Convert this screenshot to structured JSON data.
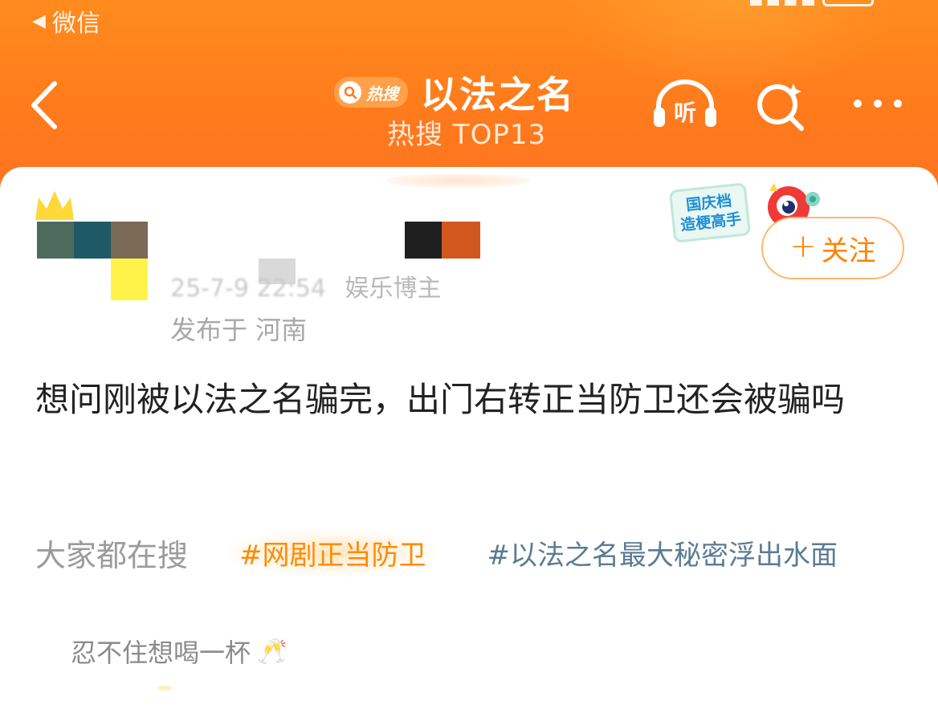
{
  "status_bar": {
    "back_label": "微信",
    "back_icon": "back-triangle-icon"
  },
  "header": {
    "hot_badge_label": "热搜",
    "title": "以法之名",
    "subtitle": "热搜 TOP13",
    "icons": [
      "back-chevron-icon",
      "listen-icon",
      "search-icon",
      "more-icon"
    ],
    "listen_label": "听"
  },
  "post": {
    "timestamp_partial": "25-7-9 22:54",
    "author_role": "娱乐博主",
    "location": "发布于 河南",
    "promo_line1": "国庆档",
    "promo_line2": "造梗高手",
    "follow_label": "关注",
    "text": "想问刚被以法之名骗完，出门右转正当防卫还会被骗吗"
  },
  "related": {
    "label": "大家都在搜",
    "topics": [
      "#网剧正当防卫",
      "#以法之名最大秘密浮出水面"
    ]
  },
  "comment": {
    "text": "忍不住想喝一杯",
    "emoji": "🥂"
  },
  "colors": {
    "brand_orange": "#ff7a1c",
    "follow_orange": "#ff8200",
    "topic_orange": "#ff8a00",
    "topic_blue": "#5b7b93"
  }
}
